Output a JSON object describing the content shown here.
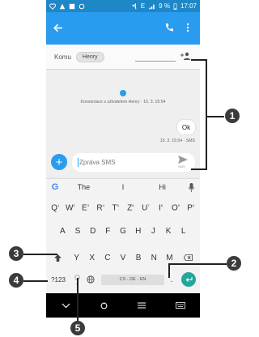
{
  "status_bar": {
    "battery_text": "9 %",
    "time": "17:07",
    "network": "E"
  },
  "compose": {
    "to_label": "Komu",
    "recipient_chip": "Henry",
    "conversation_info": "Konverzace s uživatelem Henry · 15. 3. 15:54",
    "message_text": "Ok",
    "message_meta": "15. 3. 15:54 · SMS",
    "input_placeholder": "Zpráva SMS",
    "send_label": "SMS"
  },
  "keyboard": {
    "suggestions": [
      "The",
      "I",
      "Hi"
    ],
    "row1": [
      "Q",
      "W",
      "E",
      "R",
      "T",
      "Z",
      "U",
      "I",
      "O",
      "P"
    ],
    "row1_hints": [
      "1",
      "2",
      "3",
      "4",
      "5",
      "6",
      "7",
      "8",
      "9",
      "0"
    ],
    "row2": [
      "A",
      "S",
      "D",
      "F",
      "G",
      "H",
      "J",
      "K",
      "L"
    ],
    "row3": [
      "Y",
      "X",
      "C",
      "V",
      "B",
      "N",
      "M"
    ],
    "numbers_key": "?123",
    "comma": ",",
    "space_label": "CS · DE · EN",
    "period": "."
  },
  "callouts": [
    "1",
    "2",
    "3",
    "4",
    "5"
  ],
  "colors": {
    "status_bar": "#1e87c8",
    "app_bar": "#2a9cf0",
    "accent": "#2a9cf0",
    "enter": "#26a69a"
  }
}
